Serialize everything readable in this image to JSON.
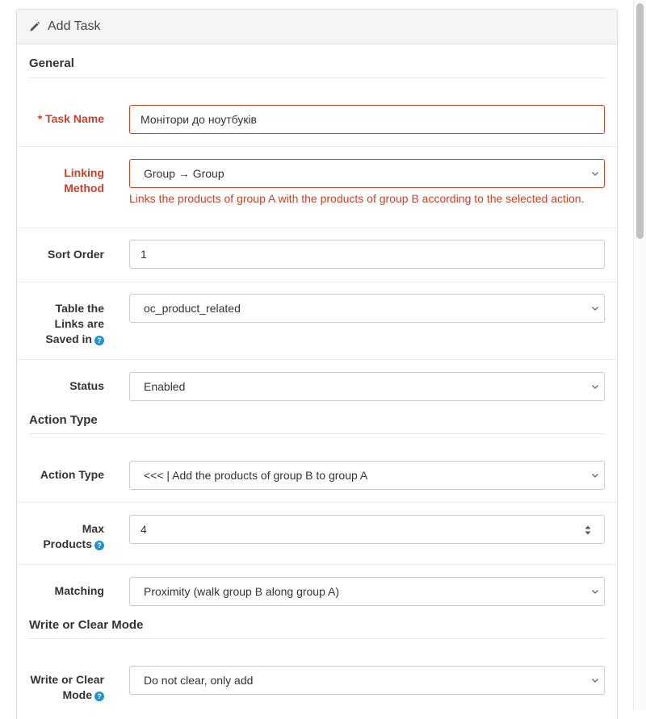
{
  "panel": {
    "title": "Add Task"
  },
  "sections": {
    "general": "General",
    "action_type": "Action Type",
    "write_clear": "Write or Clear Mode"
  },
  "fields": {
    "task_name": {
      "required_mark": "*",
      "label": "Task Name",
      "value": "Монітори до ноутбуків"
    },
    "linking_method": {
      "label_line1": "Linking",
      "label_line2": "Method",
      "value": "Group → Group",
      "help": "Links the products of group A with the products of group B according to the selected action."
    },
    "sort_order": {
      "label": "Sort Order",
      "value": "1"
    },
    "links_table": {
      "label_line1": "Table the",
      "label_line2": "Links are",
      "label_line3": "Saved in",
      "value": "oc_product_related"
    },
    "status": {
      "label": "Status",
      "value": "Enabled"
    },
    "action_type": {
      "label": "Action Type",
      "value": "<<< | Add the products of group B to group A"
    },
    "max_products": {
      "label_line1": "Max",
      "label_line2": "Products",
      "value": "4"
    },
    "matching": {
      "label": "Matching",
      "value": "Proximity (walk group B along group A)"
    },
    "write_clear_mode": {
      "label_line1": "Write or Clear",
      "label_line2": "Mode",
      "value": "Do not clear, only add"
    }
  },
  "icons": {
    "help": "question-circle-icon",
    "panel": "pencil-icon",
    "select": "chevron-down-icon",
    "number": "spinner-arrows-icon"
  },
  "colors": {
    "error": "#c9412b",
    "help_icon": "#1e91cf",
    "panel_heading_bg": "#f5f5f5",
    "border": "#cccccc"
  }
}
